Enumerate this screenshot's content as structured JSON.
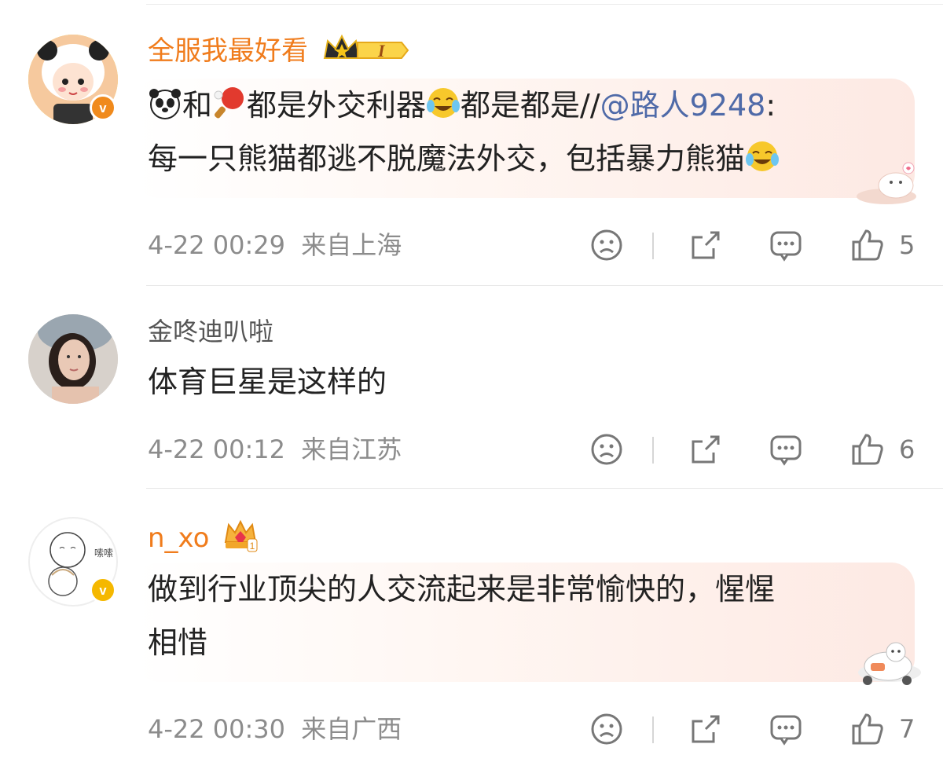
{
  "comments": [
    {
      "username": "全服我最好看",
      "badge_level": "I",
      "text_part1": "和",
      "text_part2": "都是外交利器",
      "text_part3": "都是都是//",
      "mention": "@路人9248",
      "text_part4": ":",
      "line2": "每一只熊猫都逃不脱魔法外交，包括暴力熊猫",
      "time": "4-22 00:29",
      "location": "来自上海",
      "likes": "5"
    },
    {
      "username": "金咚迪叭啦",
      "text": "体育巨星是这样的",
      "time": "4-22 00:12",
      "location": "来自江苏",
      "likes": "6"
    },
    {
      "username": "n_xo",
      "avatar_text": "嗦嗦",
      "line1": "做到行业顶尖的人交流起来是非常愉快的，惺惺",
      "line2": "相惜",
      "time": "4-22 00:30",
      "location": "来自广西",
      "likes": "7"
    }
  ],
  "colors": {
    "username_orange": "#f07c1c",
    "mention_blue": "#4f6aa8",
    "verified_orange": "#f08a1c",
    "verified_yellow": "#f5b800"
  },
  "icons": [
    "panda-icon",
    "ping-pong-icon",
    "laughing-tears-icon",
    "crown-badge-icon",
    "verified-icon",
    "dislike-face-icon",
    "share-icon",
    "comment-icon",
    "like-icon"
  ]
}
